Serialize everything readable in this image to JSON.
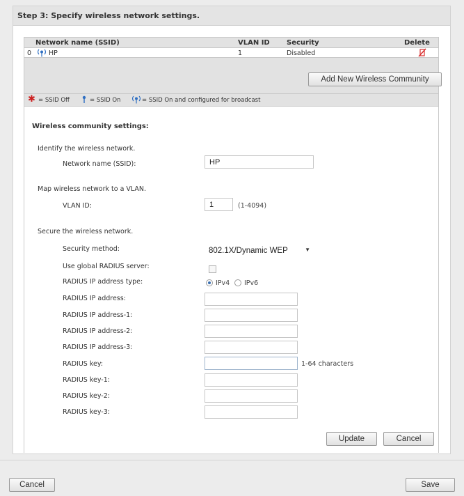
{
  "step_title": "Step 3: Specify wireless network settings.",
  "ssid_table": {
    "headers": {
      "network_name": "Network name (SSID)",
      "vlan_id": "VLAN ID",
      "security": "Security",
      "delete": "Delete"
    },
    "rows": [
      {
        "index": "0",
        "name": "HP",
        "vlan": "1",
        "security": "Disabled",
        "status_icon": "ssid-broadcast-icon",
        "delete_icon": "delete-icon"
      }
    ],
    "add_button": "Add New Wireless Community"
  },
  "legend": {
    "off": "= SSID Off",
    "on": "= SSID On",
    "broadcast": "= SSID On and configured for broadcast"
  },
  "settings": {
    "title": "Wireless community settings:",
    "identify_text": "Identify the wireless network.",
    "network_name_label": "Network name (SSID):",
    "network_name_value": "HP",
    "map_text": "Map wireless network to a VLAN.",
    "vlan_label": "VLAN ID:",
    "vlan_value": "1",
    "vlan_hint": "(1-4094)",
    "secure_text": "Secure the wireless network.",
    "security_method_label": "Security method:",
    "security_method_value": "802.1X/Dynamic WEP",
    "global_radius_label": "Use global RADIUS server:",
    "global_radius_checked": false,
    "radius_ip_type_label": "RADIUS IP address type:",
    "ipv4_label": "IPv4",
    "ipv6_label": "IPv6",
    "ip_type_selected": "IPv4",
    "radius_ip_label": "RADIUS IP address:",
    "radius_ip1_label": "RADIUS IP address-1:",
    "radius_ip2_label": "RADIUS IP address-2:",
    "radius_ip3_label": "RADIUS IP address-3:",
    "radius_key_label": "RADIUS key:",
    "radius_key_hint": "1-64 characters",
    "radius_key1_label": "RADIUS key-1:",
    "radius_key2_label": "RADIUS key-2:",
    "radius_key3_label": "RADIUS key-3:",
    "update_button": "Update",
    "cancel_button": "Cancel"
  },
  "footer": {
    "cancel_button": "Cancel",
    "save_button": "Save"
  },
  "colors": {
    "delete_red": "#d93030",
    "off_red": "#cc2020",
    "on_blue": "#2f6fc2"
  }
}
